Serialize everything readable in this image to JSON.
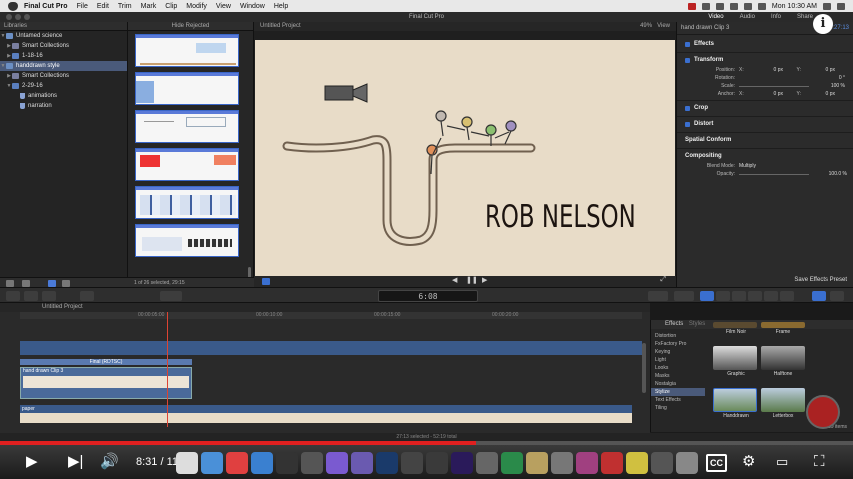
{
  "menubar": {
    "app_name": "Final Cut Pro",
    "items": [
      "File",
      "Edit",
      "Trim",
      "Mark",
      "Clip",
      "Modify",
      "View",
      "Window",
      "Help"
    ],
    "clock": "Mon 10:30 AM"
  },
  "window": {
    "title": "Final Cut Pro",
    "inspector_tabs": [
      "Video",
      "Audio",
      "Info",
      "Share"
    ]
  },
  "libraries": {
    "header": "Libraries",
    "items": [
      {
        "label": "Untamed science",
        "kind": "library"
      },
      {
        "label": "Smart Collections",
        "kind": "smart"
      },
      {
        "label": "1-18-16",
        "kind": "event"
      },
      {
        "label": "handdrawn style",
        "kind": "library",
        "selected": true
      },
      {
        "label": "Smart Collections",
        "kind": "smart"
      },
      {
        "label": "2-29-16",
        "kind": "event"
      },
      {
        "label": "animations",
        "kind": "keyword"
      },
      {
        "label": "narration",
        "kind": "keyword"
      }
    ],
    "status": "1 of 26 selected, 29:15"
  },
  "browser": {
    "filter": "Hide Rejected"
  },
  "viewer": {
    "title": "Untitled Project",
    "zoom": "49%",
    "view_label": "View",
    "overlay_text": "ROB NELSON"
  },
  "inspector": {
    "clip_name": "hand drawn Clip 3",
    "duration": "00:00:27:13",
    "sections": {
      "effects": "Effects",
      "transform": "Transform",
      "crop": "Crop",
      "distort": "Distort",
      "spatial": "Spatial Conform",
      "compositing": "Compositing"
    },
    "params": {
      "position_label": "Position:",
      "position_x": "0 px",
      "position_y": "0 px",
      "rotation_label": "Rotation:",
      "rotation": "0 °",
      "scale_label": "Scale:",
      "scale": "100 %",
      "anchor_label": "Anchor:",
      "anchor_x": "0 px",
      "anchor_y": "0 px",
      "blend_label": "Blend Mode:",
      "blend": "Multiply",
      "opacity_label": "Opacity:",
      "opacity": "100.0 %"
    },
    "save_preset": "Save Effects Preset"
  },
  "toolbar": {
    "timecode": "6:08"
  },
  "timeline": {
    "project": "Untitled Project",
    "ruler": [
      "00:00:05:00",
      "00:00:10:00",
      "00:00:15:00",
      "00:00:20:00"
    ],
    "title_clip": "Final (RDTSC)",
    "clip_name": "hand drawn Clip 3",
    "bottom_clip": "paper",
    "status": "27:13 selected - 52:19 total"
  },
  "effects_browser": {
    "tabs": [
      "Effects",
      "Styles"
    ],
    "categories": [
      "Distortion",
      "FxFactory Pro",
      "Keying",
      "Light",
      "Looks",
      "Masks",
      "Nostalgia",
      "Stylize",
      "Text Effects",
      "Tiling"
    ],
    "selected_category": "Stylize",
    "tiles": [
      "Film Noir",
      "Frame",
      "Graphic",
      "Halftone",
      "Handdrawn",
      "Letterbox"
    ],
    "count": "29 items"
  },
  "player": {
    "current": "8:31",
    "total": "11:32",
    "time_sep": "/",
    "progress": 0.558,
    "cc_label": "CC"
  }
}
